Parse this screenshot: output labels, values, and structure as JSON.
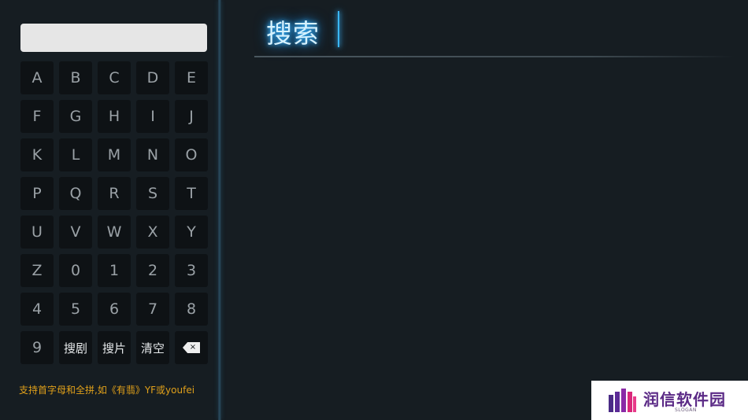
{
  "search": {
    "value": "",
    "placeholder": ""
  },
  "keyboard": {
    "keys": [
      "A",
      "B",
      "C",
      "D",
      "E",
      "F",
      "G",
      "H",
      "I",
      "J",
      "K",
      "L",
      "M",
      "N",
      "O",
      "P",
      "Q",
      "R",
      "S",
      "T",
      "U",
      "V",
      "W",
      "X",
      "Y",
      "Z",
      "0",
      "1",
      "2",
      "3",
      "4",
      "5",
      "6",
      "7",
      "8",
      "9"
    ],
    "search_drama_label": "搜剧",
    "search_movie_label": "搜片",
    "clear_label": "清空",
    "backspace_glyph": "×",
    "backspace_icon": "backspace-icon"
  },
  "hint": "支持首字母和全拼,如《有翡》YF或youfei",
  "results": {
    "title": "搜索"
  },
  "watermark": {
    "text": "润信软件园",
    "sub": "SLOGAN"
  },
  "colors": {
    "background": "#161d22",
    "key_background": "#0e1215",
    "key_text": "#9aa1a6",
    "hint_text": "#e0a01a",
    "title_glow": "#3ab7ff",
    "watermark_brand": "#5b2a86"
  }
}
